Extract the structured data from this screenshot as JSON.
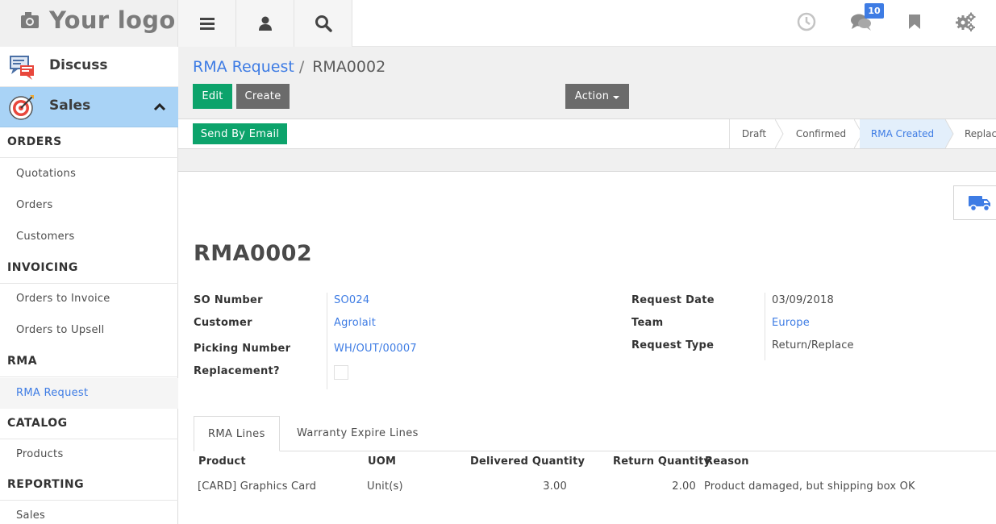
{
  "topbar": {
    "logo": "Your logo",
    "menu_icon": "hamburger-icon",
    "user_icon": "user-icon",
    "search_icon": "search-icon",
    "activity_icon": "clock-icon",
    "messages_icon": "chat-icon",
    "messages_count": "10",
    "bookmark_icon": "bookmark-icon",
    "settings_icon": "gears-icon"
  },
  "sidebar": {
    "apps": [
      {
        "label": "Discuss",
        "icon": "discuss-icon"
      },
      {
        "label": "Sales",
        "icon": "target-icon"
      }
    ],
    "sections": [
      {
        "title": "ORDERS",
        "items": [
          "Quotations",
          "Orders",
          "Customers"
        ]
      },
      {
        "title": "INVOICING",
        "items": [
          "Orders to Invoice",
          "Orders to Upsell"
        ]
      },
      {
        "title": "RMA",
        "items": [
          "RMA Request"
        ]
      },
      {
        "title": "CATALOG",
        "items": [
          "Products"
        ]
      },
      {
        "title": "REPORTING",
        "items": [
          "Sales"
        ]
      }
    ]
  },
  "control_panel": {
    "breadcrumb_parent": "RMA Request",
    "breadcrumb_sep": "/",
    "breadcrumb_current": "RMA0002",
    "edit_label": "Edit",
    "create_label": "Create",
    "action_label": "Action"
  },
  "statusbar": {
    "email_label": "Send By Email",
    "stages": [
      "Draft",
      "Confirmed",
      "RMA Created",
      "Replac"
    ],
    "active_stage": "RMA Created"
  },
  "form": {
    "smart_button_icon": "truck-icon",
    "title": "RMA0002",
    "left_fields": [
      {
        "label": "SO Number",
        "value": "SO024"
      },
      {
        "label": "Customer",
        "value": "Agrolait"
      },
      {
        "label": "Picking Number",
        "value": "WH/OUT/00007"
      },
      {
        "label": "Replacement?",
        "value": ""
      }
    ],
    "right_fields": [
      {
        "label": "Request Date",
        "value": "03/09/2018"
      },
      {
        "label": "Team",
        "value": "Europe"
      },
      {
        "label": "Request Type",
        "value": "Return/Replace"
      }
    ],
    "tabs": [
      "RMA Lines",
      "Warranty Expire Lines"
    ],
    "lines": {
      "headers": [
        "Product",
        "UOM",
        "Delivered Quantity",
        "Return Quantity",
        "Reason"
      ],
      "rows": [
        [
          "[CARD] Graphics Card",
          "Unit(s)",
          "3.00",
          "2.00",
          "Product damaged, but shipping box OK"
        ]
      ]
    }
  },
  "colors": {
    "accent": "#3e7ce4",
    "primary_button": "#0ca36b",
    "secondary_button": "#6b6b6b",
    "sales_highlight": "#a9d3f6",
    "active_stage_bg": "#e3effb"
  }
}
